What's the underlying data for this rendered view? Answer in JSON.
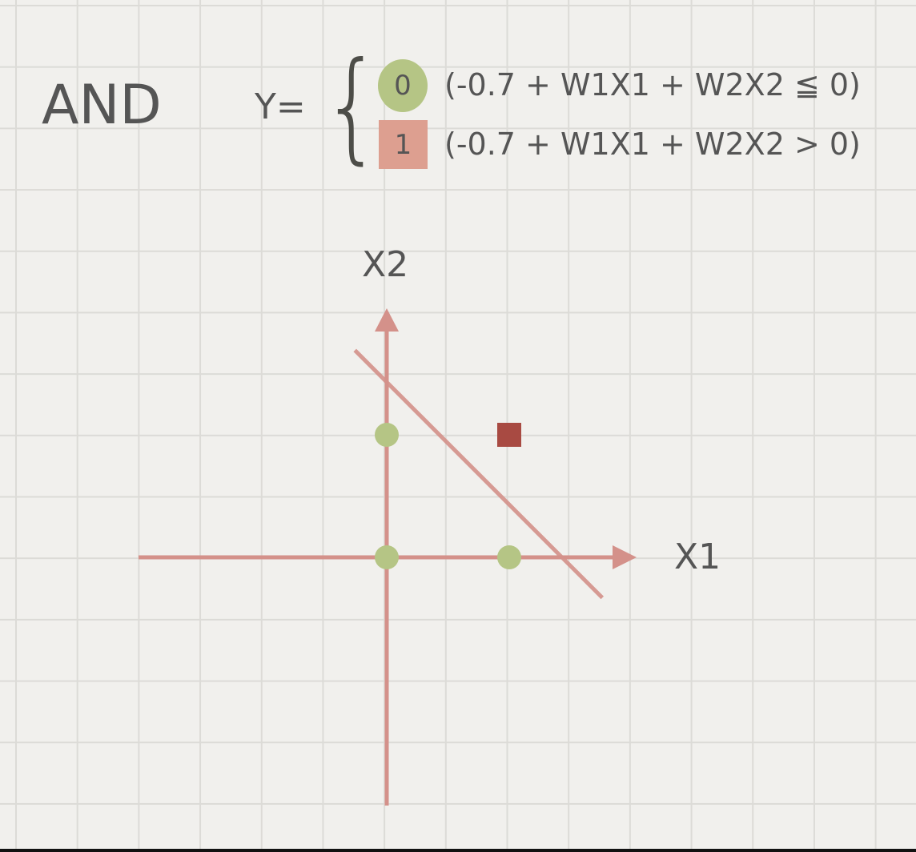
{
  "title": "AND",
  "formula": {
    "lhs": "Y=",
    "brace": "{",
    "cases": [
      {
        "output": "0",
        "condition": "(-0.7 + W1X1 + W2X2 ≦ 0)",
        "marker": "circle",
        "color": "#b5c585"
      },
      {
        "output": "1",
        "condition": "(-0.7 + W1X1 + W2X2 > 0)",
        "marker": "square",
        "color": "#dd9f90"
      }
    ]
  },
  "plot": {
    "x_axis_label": "X1",
    "y_axis_label": "X2",
    "axis_color": "#d4918a",
    "points": [
      {
        "x": 0,
        "y": 0,
        "class": 0,
        "marker": "circle",
        "color": "#b5c585"
      },
      {
        "x": 1,
        "y": 0,
        "class": 0,
        "marker": "circle",
        "color": "#b5c585"
      },
      {
        "x": 0,
        "y": 1,
        "class": 0,
        "marker": "circle",
        "color": "#b5c585"
      },
      {
        "x": 1,
        "y": 1,
        "class": 1,
        "marker": "square",
        "color": "#a84a42"
      }
    ],
    "decision_boundary": {
      "from": [
        -0.26,
        1.69
      ],
      "to": [
        1.76,
        -0.33
      ],
      "color": "#d4918a"
    }
  }
}
